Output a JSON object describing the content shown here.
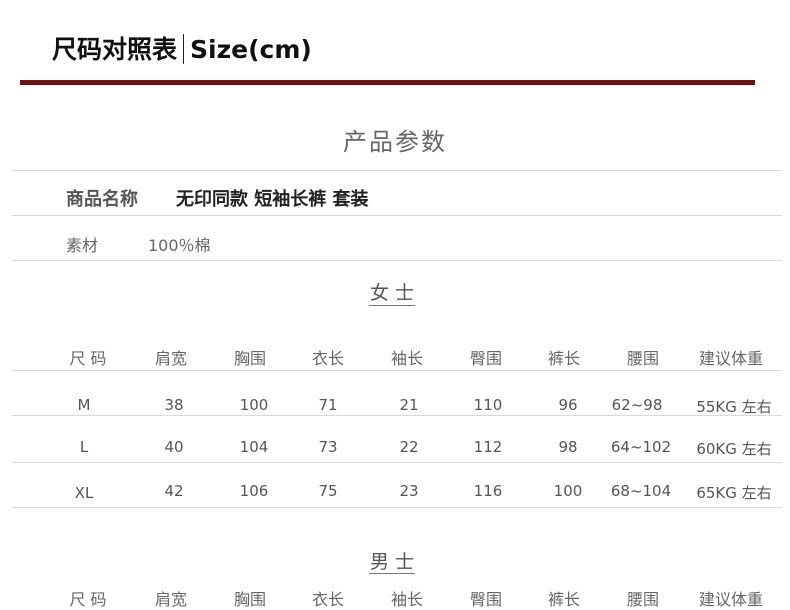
{
  "header": {
    "title_cn": "尺码对照表",
    "title_en": "Size(cm)"
  },
  "params": {
    "title": "产品参数",
    "name_label": "商品名称",
    "name_value": "无印同款 短袖长裤 套装",
    "material_label": "素材",
    "material_value": "100％棉"
  },
  "women": {
    "title": "女士",
    "headers": [
      "尺 码",
      "肩宽",
      "胸围",
      "衣长",
      "袖长",
      "臀围",
      "裤长",
      "腰围",
      "建议体重"
    ],
    "rows": [
      [
        "M",
        "38",
        "100",
        "71",
        "21",
        "110",
        "96",
        "62~98",
        "55KG 左右"
      ],
      [
        "L",
        "40",
        "104",
        "73",
        "22",
        "112",
        "98",
        "64~102",
        "60KG 左右"
      ],
      [
        "XL",
        "42",
        "106",
        "75",
        "23",
        "116",
        "100",
        "68~104",
        "65KG 左右"
      ]
    ]
  },
  "men": {
    "title": "男士",
    "headers": [
      "尺 码",
      "肩宽",
      "胸围",
      "衣长",
      "袖长",
      "臀围",
      "裤长",
      "腰围",
      "建议体重"
    ]
  }
}
